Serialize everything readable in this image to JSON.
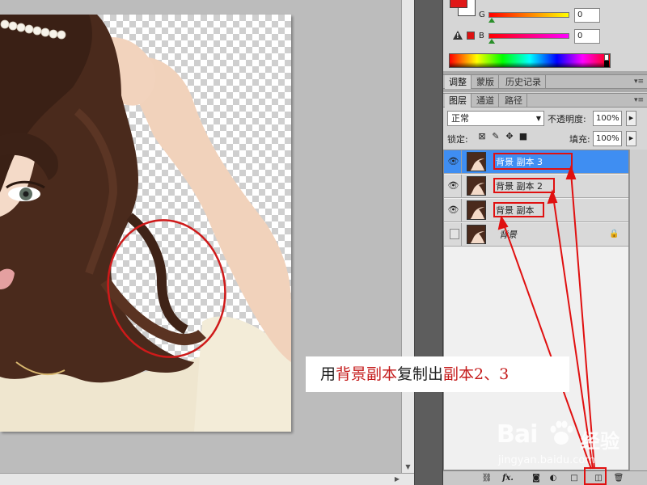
{
  "canvas": {
    "photo_alt": "portrait of woman with brown wavy hair, hand raised to head, on transparent checkerboard background"
  },
  "color_panel": {
    "channels": [
      {
        "label": "G",
        "value": "0",
        "gradient": [
          "#ff0000",
          "#ffff00"
        ]
      },
      {
        "label": "B",
        "value": "0",
        "gradient": [
          "#ff0000",
          "#ff00ff"
        ]
      }
    ],
    "foreground_color": "#e01818",
    "background_color": "#ffffff"
  },
  "adjust_tabs": [
    {
      "label": "调整",
      "active": true
    },
    {
      "label": "蒙版",
      "active": false
    },
    {
      "label": "历史记录",
      "active": false
    }
  ],
  "layers_tabs": [
    {
      "label": "图层",
      "active": true
    },
    {
      "label": "通道",
      "active": false
    },
    {
      "label": "路径",
      "active": false
    }
  ],
  "panel_menu_icon": "panel-menu-icon",
  "layers_controls": {
    "blend_mode": "正常",
    "opacity_label": "不透明度:",
    "opacity_value": "100%",
    "lock_label": "锁定:",
    "fill_label": "填充:",
    "fill_value": "100%"
  },
  "layers": [
    {
      "name": "背景 副本 3",
      "visible": true,
      "selected": true,
      "highlighted": true
    },
    {
      "name": "背景 副本 2",
      "visible": true,
      "selected": false,
      "highlighted": true
    },
    {
      "name": "背景 副本",
      "visible": true,
      "selected": false,
      "highlighted": true
    },
    {
      "name": "背景",
      "visible": false,
      "selected": false,
      "highlighted": false,
      "locked": true
    }
  ],
  "footer_icons": [
    "link-icon",
    "fx-icon",
    "mask-icon",
    "adjustment-icon",
    "group-icon",
    "new-layer-icon",
    "trash-icon"
  ],
  "footer_labels": {
    "fx": "fx."
  },
  "caption": {
    "part1": "用",
    "part2": "背景副本",
    "part3": "复制出",
    "part4": "副本2、3"
  },
  "watermark": {
    "logo": "Bai",
    "suffix": "经验",
    "url": "jingyan.baidu.com"
  },
  "accent_colors": {
    "selection": "#3f8ef2",
    "annotation": "#e01010"
  }
}
